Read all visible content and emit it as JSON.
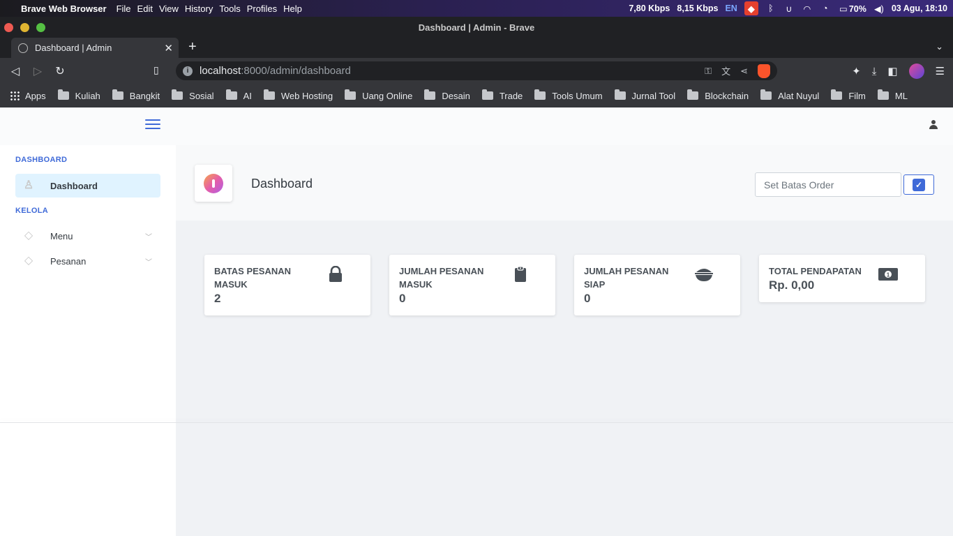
{
  "system_bar": {
    "app_name": "Brave Web Browser",
    "menus": [
      "File",
      "Edit",
      "View",
      "History",
      "Tools",
      "Profiles",
      "Help"
    ],
    "net_down": "7,80 Kbps",
    "net_up": "8,15 Kbps",
    "lang": "EN",
    "battery": "70%",
    "datetime": "03 Agu, 18:10"
  },
  "window": {
    "title": "Dashboard | Admin - Brave"
  },
  "tab": {
    "title": "Dashboard | Admin"
  },
  "address": {
    "host": "localhost",
    "path": ":8000/admin/dashboard"
  },
  "bookmarks": {
    "apps_label": "Apps",
    "folders": [
      "Kuliah",
      "Bangkit",
      "Sosial",
      "AI",
      "Web Hosting",
      "Uang Online",
      "Desain",
      "Trade",
      "Tools Umum",
      "Jurnal Tool",
      "Blockchain",
      "Alat Nuyul",
      "Film",
      "ML"
    ]
  },
  "sidebar": {
    "heading_dashboard": "DASHBOARD",
    "item_dashboard": "Dashboard",
    "heading_kelola": "KELOLA",
    "item_menu": "Menu",
    "item_pesanan": "Pesanan"
  },
  "header": {
    "title": "Dashboard",
    "batas_placeholder": "Set Batas Order"
  },
  "cards": [
    {
      "title": "BATAS PESANAN MASUK",
      "value": "2",
      "icon": "lock-icon"
    },
    {
      "title": "JUMLAH PESANAN MASUK",
      "value": "0",
      "icon": "clipboard-icon"
    },
    {
      "title": "JUMLAH PESANAN SIAP",
      "value": "0",
      "icon": "bowl-icon"
    },
    {
      "title": "TOTAL PENDAPATAN",
      "value": "Rp. 0,00",
      "icon": "money-bill-icon"
    }
  ],
  "colors": {
    "accent": "#3f6ad8",
    "active_item_bg": "#e0f3ff",
    "brave_orange": "#fb542b"
  }
}
